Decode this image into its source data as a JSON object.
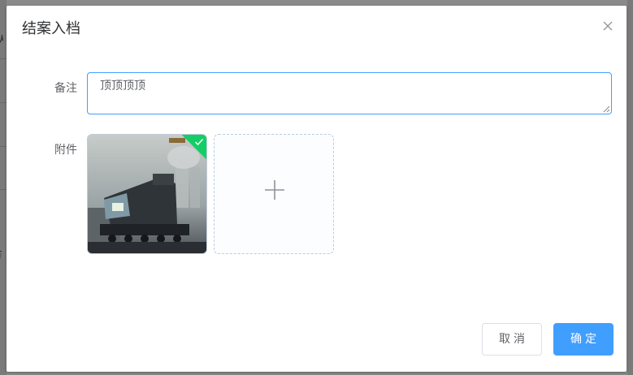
{
  "background": {
    "left_glyphs": [
      "人",
      "前"
    ]
  },
  "dialog": {
    "title": "结案入档",
    "close_icon": "close-icon"
  },
  "form": {
    "remark_label": "备注",
    "remark_value": "顶顶顶顶",
    "attachment_label": "附件"
  },
  "upload": {
    "status": "success",
    "add_icon": "plus-icon"
  },
  "footer": {
    "cancel_label": "取消",
    "confirm_label": "确定"
  },
  "colors": {
    "primary": "#409eff",
    "success": "#13ce66",
    "title_text": "#303133",
    "label_text": "#606266"
  }
}
